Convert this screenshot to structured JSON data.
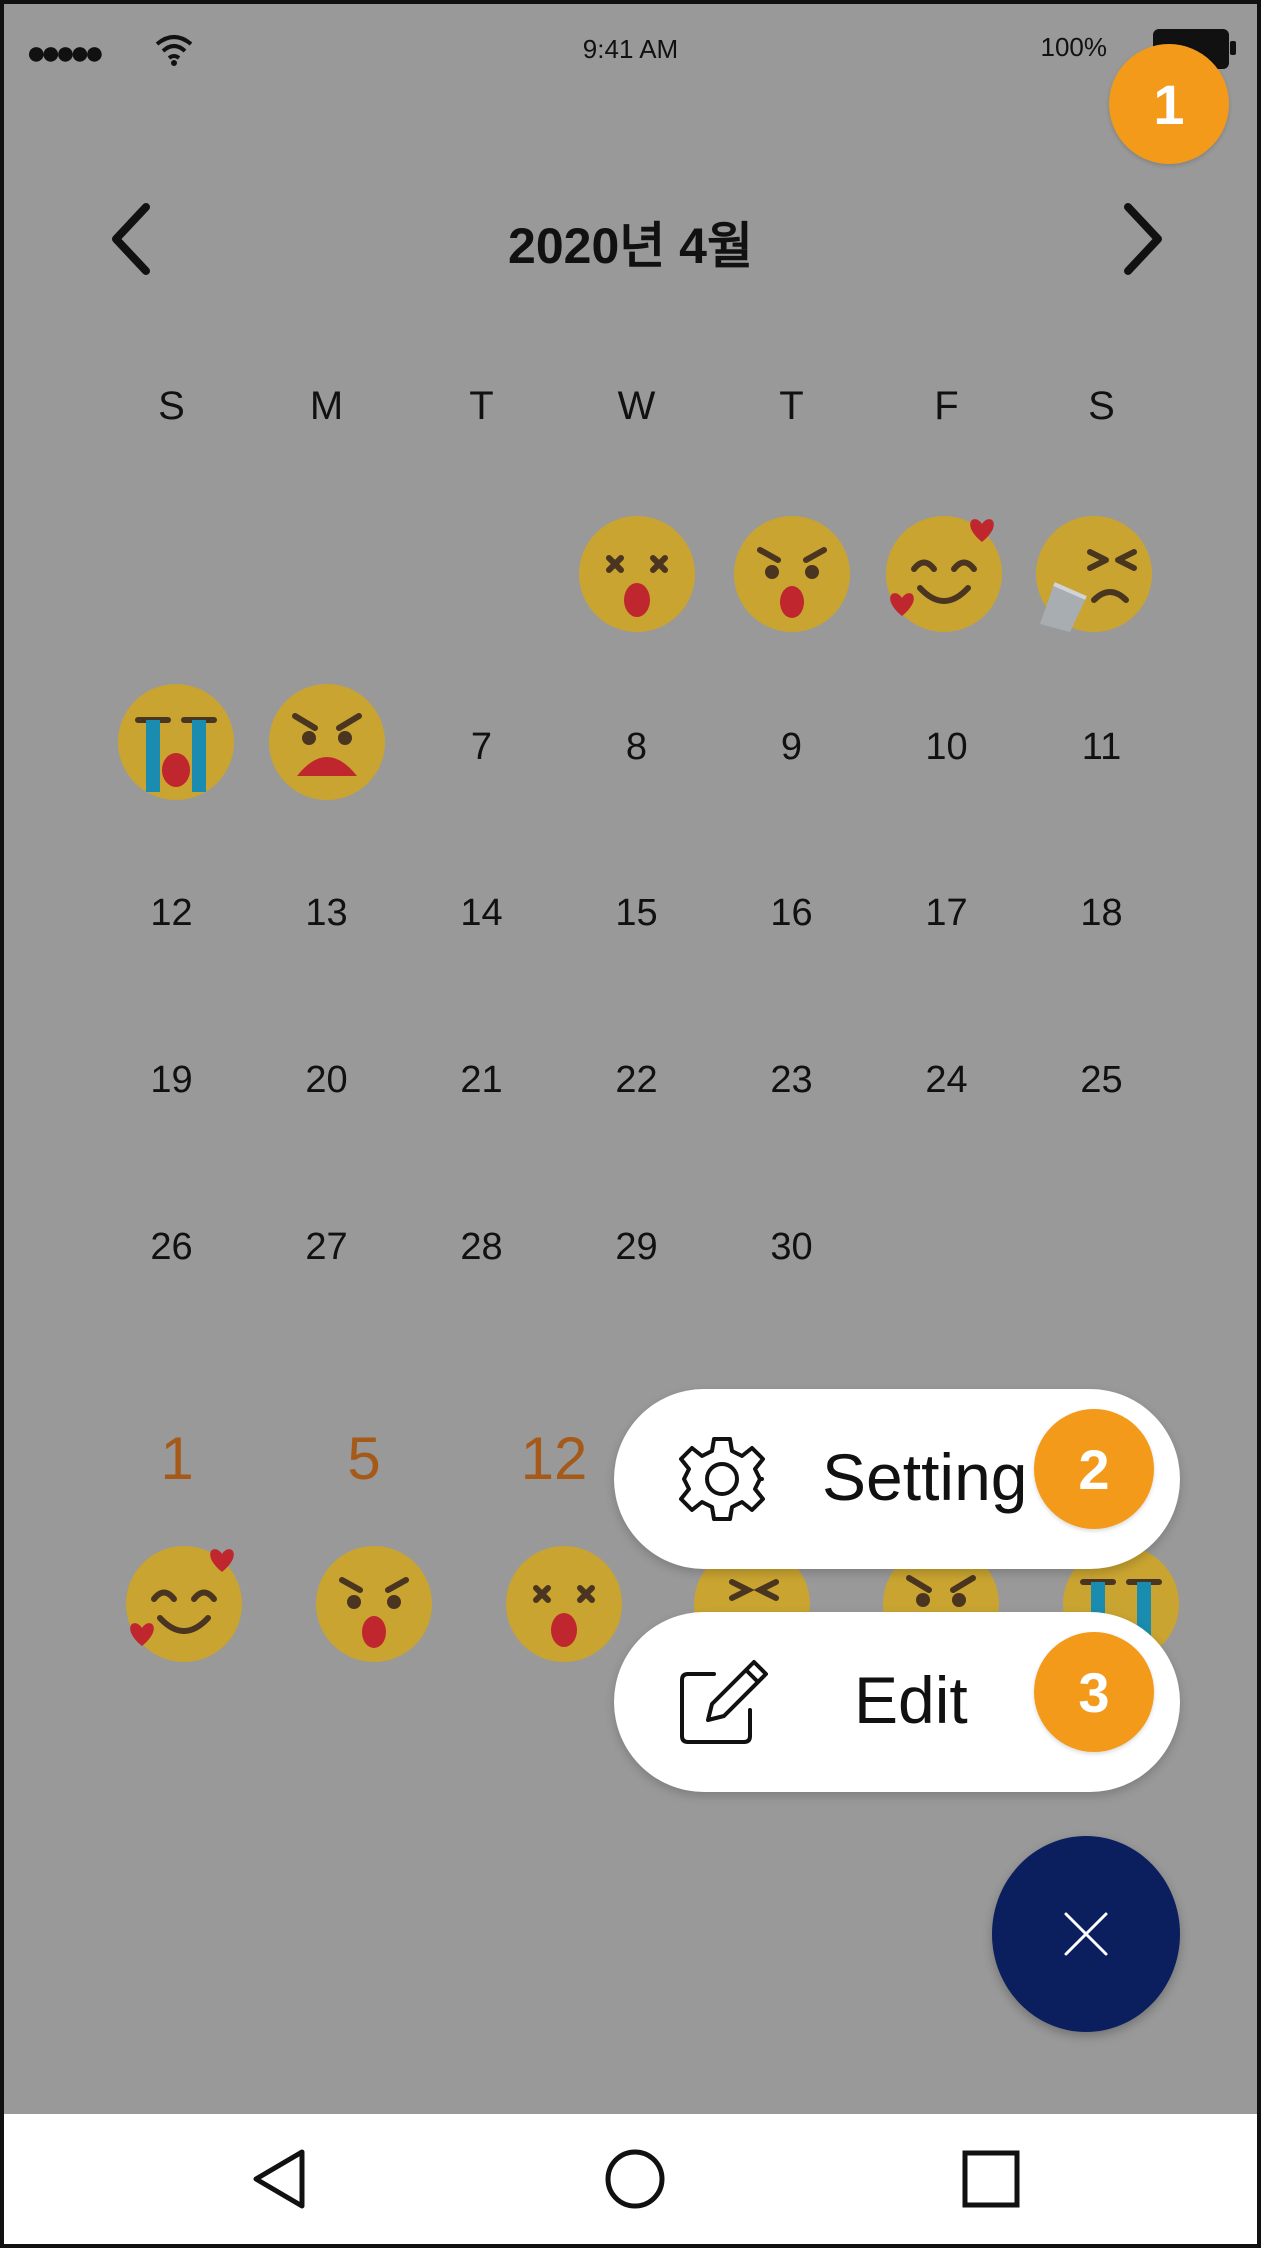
{
  "status_bar": {
    "signal": "●●●●●",
    "time": "9:41 AM",
    "battery": "100%"
  },
  "header": {
    "title": "2020년 4월",
    "prev_icon": "chevron-left-icon",
    "next_icon": "chevron-right-icon"
  },
  "weekdays": [
    "S",
    "M",
    "T",
    "W",
    "T",
    "F",
    "S"
  ],
  "calendar": {
    "emoji_days": [
      "dizzy-face-icon",
      "angry-shocked-face-icon",
      "smiling-face-with-hearts-icon",
      "sneezing-face-icon",
      "crying-face-icon",
      "angry-face-icon"
    ],
    "days": [
      "7",
      "8",
      "9",
      "10",
      "11",
      "12",
      "13",
      "14",
      "15",
      "16",
      "17",
      "18",
      "19",
      "20",
      "21",
      "22",
      "23",
      "24",
      "25",
      "26",
      "27",
      "28",
      "29",
      "30"
    ]
  },
  "stats": {
    "counts": [
      "1",
      "5",
      "12"
    ]
  },
  "menu": {
    "setting_label": "Setting",
    "edit_label": "Edit",
    "setting_icon": "gear-icon",
    "edit_icon": "edit-icon",
    "close_icon": "close-icon"
  },
  "badges": [
    "1",
    "2",
    "3"
  ],
  "colors": {
    "overlay": "#999999",
    "badge": "#f39a1b",
    "fab": "#0b1f5e",
    "emoji": "#c9a431",
    "stat_number": "#a55a19"
  }
}
